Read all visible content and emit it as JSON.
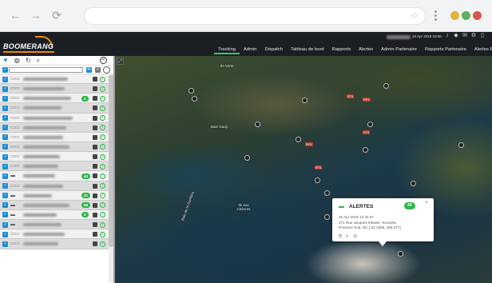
{
  "browser": {
    "address": "",
    "nav": {
      "back": "←",
      "forward": "→",
      "reload": "⟳"
    },
    "star": "☆"
  },
  "app": {
    "logo": {
      "prefix": "BOO",
      "accent": "MERANG"
    },
    "header": {
      "datetime": "16 Apr 2019 10:06"
    },
    "menu": [
      "Tracking",
      "Admin",
      "Dispatch",
      "Tableau de bord",
      "Rapports",
      "Alertes",
      "Admin Partenaire",
      "Rapports Partenaire",
      "Alertes Partenaire"
    ],
    "active_menu": "Tracking"
  },
  "sidebar": {
    "tools": {
      "filter": "▼",
      "globe": "◍",
      "refresh": "↻",
      "search": "⌕",
      "collapse": "«"
    },
    "rows": [
      {
        "badge": ""
      },
      {
        "badge": ""
      },
      {
        "badge": "3"
      },
      {
        "badge": ""
      },
      {
        "badge": ""
      },
      {
        "badge": ""
      },
      {
        "badge": ""
      },
      {
        "badge": ""
      },
      {
        "badge": ""
      },
      {
        "badge": ""
      },
      {
        "badge": "44"
      },
      {
        "badge": ""
      },
      {
        "badge": "31"
      },
      {
        "badge": "68"
      },
      {
        "badge": "3"
      },
      {
        "badge": ""
      },
      {
        "badge": ""
      },
      {
        "badge": ""
      }
    ]
  },
  "map": {
    "places": {
      "baie_gadji": "Baie Gadji",
      "ile_verte": "Ile Verte",
      "baie_dumbea": "Baie de la Dumbéa",
      "ile_aux_chevres": "Ile aux Chèvres"
    },
    "roads": [
      "RT1",
      "RP1",
      "RT1",
      "RP1",
      "RT1"
    ]
  },
  "popup": {
    "title": "ALERTES",
    "badge": "44",
    "datetime": "16 Apr 2019 12:32:37",
    "address1": "271 Rue Jacques Iékawé, Nouméa,",
    "address2": "Province Sud, NC [-22.2355, 166.477]",
    "close": "×"
  },
  "colors": {
    "accent": "#2fb64b",
    "brand": "#f08a00",
    "checkbox": "#1c8fd6"
  }
}
